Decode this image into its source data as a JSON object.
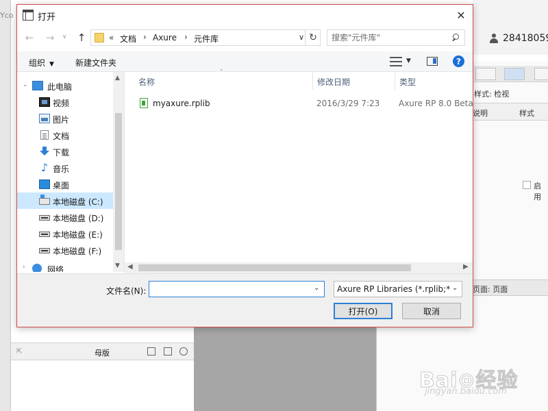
{
  "background": {
    "top_left_fragment": "Yco",
    "user_number": "28418059",
    "right_panel": {
      "inspect_label": "样式: 检视",
      "col_desc": "说明",
      "col_style": "样式",
      "enable_label": "启用",
      "page_label": "页面: 页面"
    },
    "master_panel": {
      "title": "母版"
    },
    "watermark": {
      "brand": "Bai⊙经验",
      "url": "jingyan.baidu.com"
    }
  },
  "dialog": {
    "title": "打开",
    "close_symbol": "✕",
    "nav": {
      "back": "←",
      "forward": "→",
      "up": "↑",
      "dropdown": "∨"
    },
    "address": {
      "overflow": "«",
      "crumbs": [
        "文档",
        "Axure",
        "元件库"
      ],
      "separator": "›",
      "dropdown": "∨",
      "refresh": "↻"
    },
    "search": {
      "placeholder": "搜索\"元件库\""
    },
    "commands": {
      "organize": "组织",
      "new_folder": "新建文件夹",
      "help": "?"
    },
    "nav_pane": [
      {
        "label": "此电脑",
        "icon": "pc-icon"
      },
      {
        "label": "视频",
        "icon": "video-icon"
      },
      {
        "label": "图片",
        "icon": "picture-icon"
      },
      {
        "label": "文档",
        "icon": "document-icon"
      },
      {
        "label": "下载",
        "icon": "download-icon"
      },
      {
        "label": "音乐",
        "icon": "music-icon"
      },
      {
        "label": "桌面",
        "icon": "desktop-icon"
      },
      {
        "label": "本地磁盘 (C:)",
        "icon": "drive-c-icon",
        "selected": true
      },
      {
        "label": "本地磁盘 (D:)",
        "icon": "drive-icon"
      },
      {
        "label": "本地磁盘 (E:)",
        "icon": "drive-icon"
      },
      {
        "label": "本地磁盘 (F:)",
        "icon": "drive-icon"
      },
      {
        "label": "网络",
        "icon": "network-icon"
      }
    ],
    "columns": {
      "name": "名称",
      "modified": "修改日期",
      "type": "类型"
    },
    "files": [
      {
        "name": "myaxure.rplib",
        "modified": "2016/3/29 7:23",
        "type": "Axure RP 8.0 Beta"
      }
    ],
    "filename": {
      "label": "文件名(N):",
      "value": ""
    },
    "filetype": {
      "selected": "Axure RP Libraries (*.rplib;*.r"
    },
    "buttons": {
      "open": "打开(O)",
      "cancel": "取消"
    }
  },
  "colors": {
    "accent": "#2d7fd6",
    "dialog_border": "#d24a4a",
    "selection": "#cce8ff"
  }
}
